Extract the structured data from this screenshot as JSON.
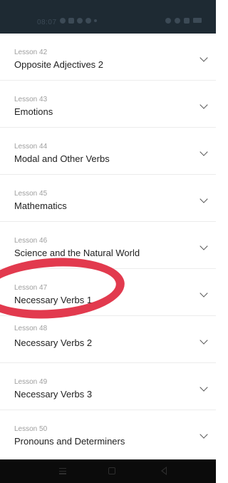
{
  "status_bar": {
    "time": "08:07",
    "left_icons": [
      "whatsapp-icon",
      "message-icon",
      "app-icon",
      "instagram-icon",
      "dot-icon"
    ],
    "right_icons": [
      "alarm-icon",
      "wifi-icon",
      "signal-icon",
      "battery-icon"
    ]
  },
  "lessons": [
    {
      "number": "Lesson 42",
      "title": "Opposite Adjectives 2"
    },
    {
      "number": "Lesson 43",
      "title": "Emotions"
    },
    {
      "number": "Lesson 44",
      "title": "Modal and Other Verbs"
    },
    {
      "number": "Lesson 45",
      "title": "Mathematics"
    },
    {
      "number": "Lesson 46",
      "title": "Science and the Natural World"
    },
    {
      "number": "Lesson 47",
      "title": "Necessary Verbs 1"
    },
    {
      "number": "Lesson 48",
      "title": "Necessary Verbs 2"
    },
    {
      "number": "Lesson 49",
      "title": "Necessary Verbs 3"
    },
    {
      "number": "Lesson 50",
      "title": "Pronouns and Determiners"
    }
  ],
  "nav_bar": {
    "icons": [
      "menu-icon",
      "home-icon",
      "back-icon"
    ]
  },
  "colors": {
    "status_bar_bg": "#1e2a33",
    "annotation": "#e23a4e",
    "nav_bar_bg": "#0b0b0b"
  }
}
